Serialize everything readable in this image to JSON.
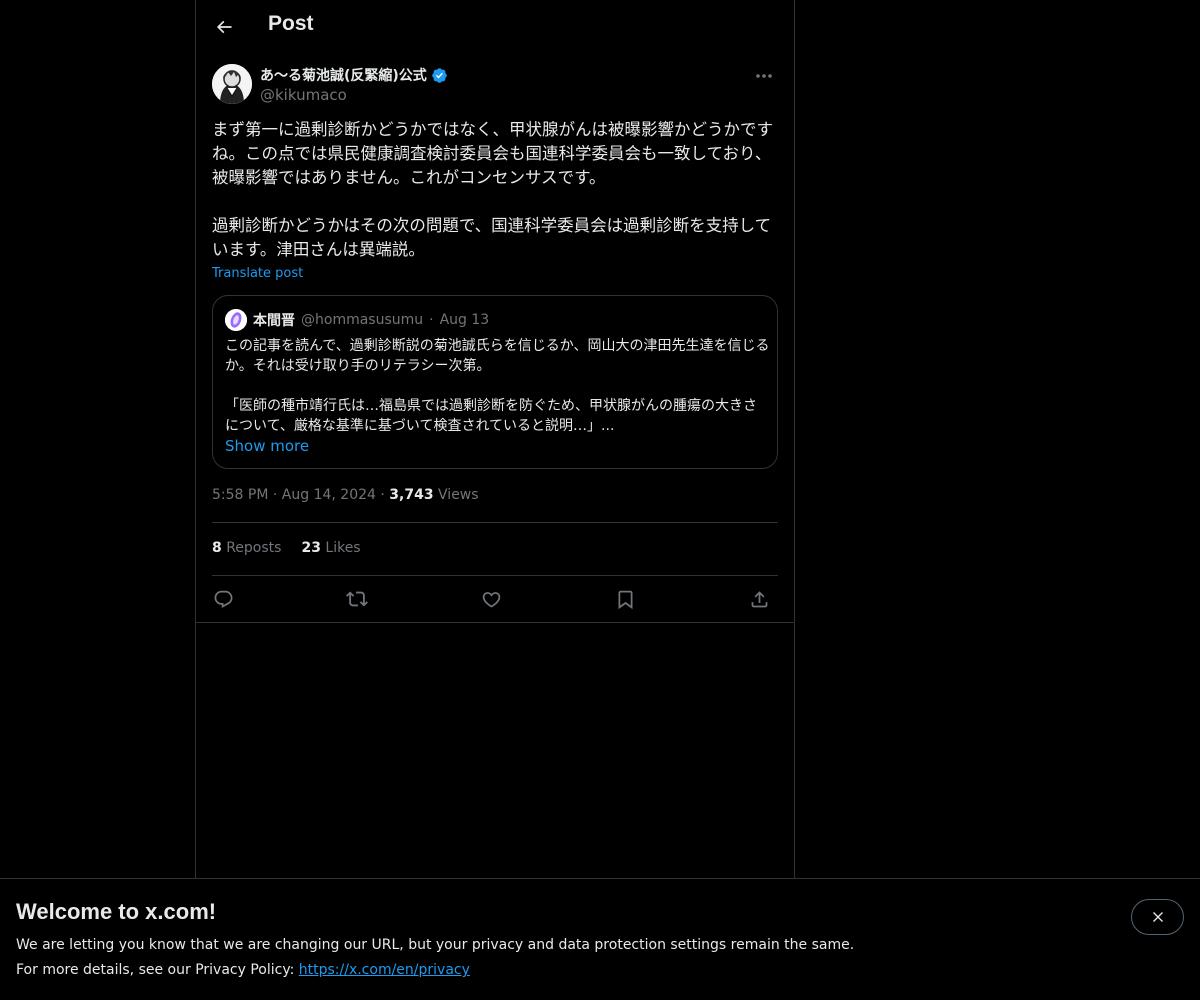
{
  "header": {
    "title": "Post"
  },
  "author": {
    "display_name": "あ〜る菊池誠(反緊縮)公式",
    "handle": "@kikumaco"
  },
  "post": {
    "text": "まず第一に過剰診断かどうかではなく、甲状腺がんは被曝影響かどうかですね。この点では県民健康調査検討委員会も国連科学委員会も一致しており、被曝影響ではありません。これがコンセンサスです。\n\n過剰診断かどうかはその次の問題で、国連科学委員会は過剰診断を支持しています。津田さんは異端説。",
    "translate_label": "Translate post",
    "time": "5:58 PM",
    "date": "Aug 14, 2024",
    "views_count": "3,743",
    "views_label": "Views"
  },
  "quote": {
    "name": "本間晋",
    "handle": "@hommasusumu",
    "dot": "·",
    "date": "Aug 13",
    "text": "この記事を読んで、過剰診断説の菊池誠氏らを信じるか、岡山大の津田先生達を信じるか。それは受け取り手のリテラシー次第。\n\n「医師の種市靖行氏は…福島県では過剰診断を防ぐため、甲状腺がんの腫瘍の大きさについて、厳格な基準に基づいて検査されていると説明…」...",
    "show_more": "Show more"
  },
  "stats": {
    "reposts_count": "8",
    "reposts_label": "Reposts",
    "likes_count": "23",
    "likes_label": "Likes"
  },
  "banner": {
    "title": "Welcome to x.com!",
    "line1": "We are letting you know that we are changing our URL, but your privacy and data protection settings remain the same.",
    "line2_prefix": "For more details, see our Privacy Policy:",
    "link": "https://x.com/en/privacy"
  },
  "meta_separator": "·",
  "colors": {
    "background": "#000000",
    "text": "#e7e9ea",
    "secondary": "#71767b",
    "accent": "#1d9bf0",
    "border": "#2f3336"
  },
  "icons": [
    "back-arrow-icon",
    "verified-badge-icon",
    "more-icon",
    "reply-icon",
    "repost-icon",
    "like-icon",
    "bookmark-icon",
    "share-icon",
    "close-icon"
  ]
}
